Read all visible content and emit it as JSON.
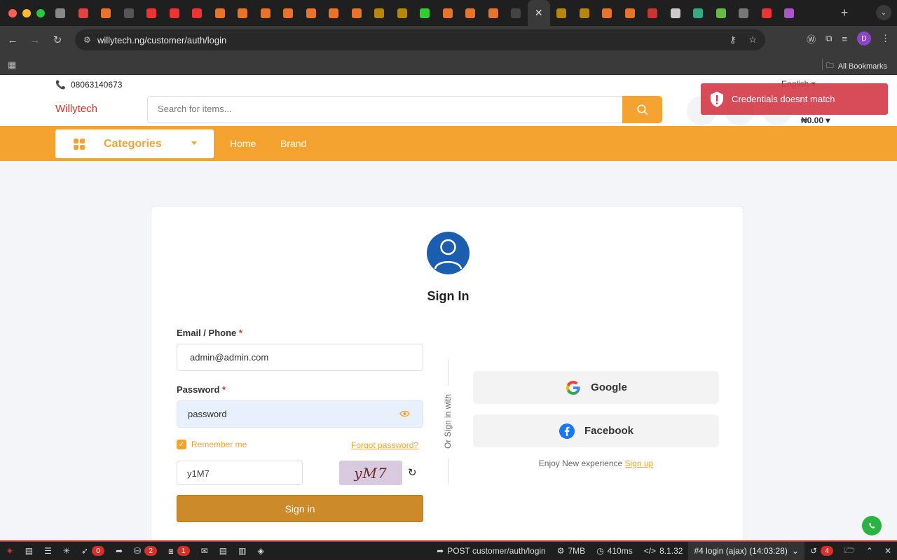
{
  "browser": {
    "url": "willytech.ng/customer/auth/login",
    "bookmarks_label": "All Bookmarks",
    "profile_initial": "D",
    "tab_count": 33
  },
  "site": {
    "phone": "08063140673",
    "language": "English",
    "logo_alt": "Willytech",
    "search_placeholder": "Search for items...",
    "cart_total": "₦0.00",
    "categories_label": "Categories",
    "nav_links": [
      "Home",
      "Brand"
    ]
  },
  "toast": {
    "message": "Credentials doesnt match"
  },
  "login": {
    "title": "Sign In",
    "email_label": "Email / Phone",
    "email_value": "admin@admin.com",
    "password_label": "Password",
    "password_value": "password",
    "remember_label": "Remember me",
    "forgot_label": "Forgot password?",
    "captcha_value": "y1M7",
    "captcha_image_text": "yM7",
    "signin_button": "Sign in",
    "or_text": "Or Sign in with",
    "google_label": "Google",
    "facebook_label": "Facebook",
    "enjoy_text": "Enjoy New experience",
    "signup_link": "Sign up"
  },
  "debugbar": {
    "badges": [
      "0",
      "2",
      "1"
    ],
    "request": "POST customer/auth/login",
    "memory": "7MB",
    "time": "410ms",
    "php_version": "8.1.32",
    "selected_request": "#4 login (ajax) (14:03:28)",
    "history_count": "4"
  },
  "colors": {
    "brand_orange": "#f5a330",
    "toast_red": "#d53c4b",
    "avatar_blue": "#1b5eb0",
    "signin_button": "#cc8a2a"
  }
}
